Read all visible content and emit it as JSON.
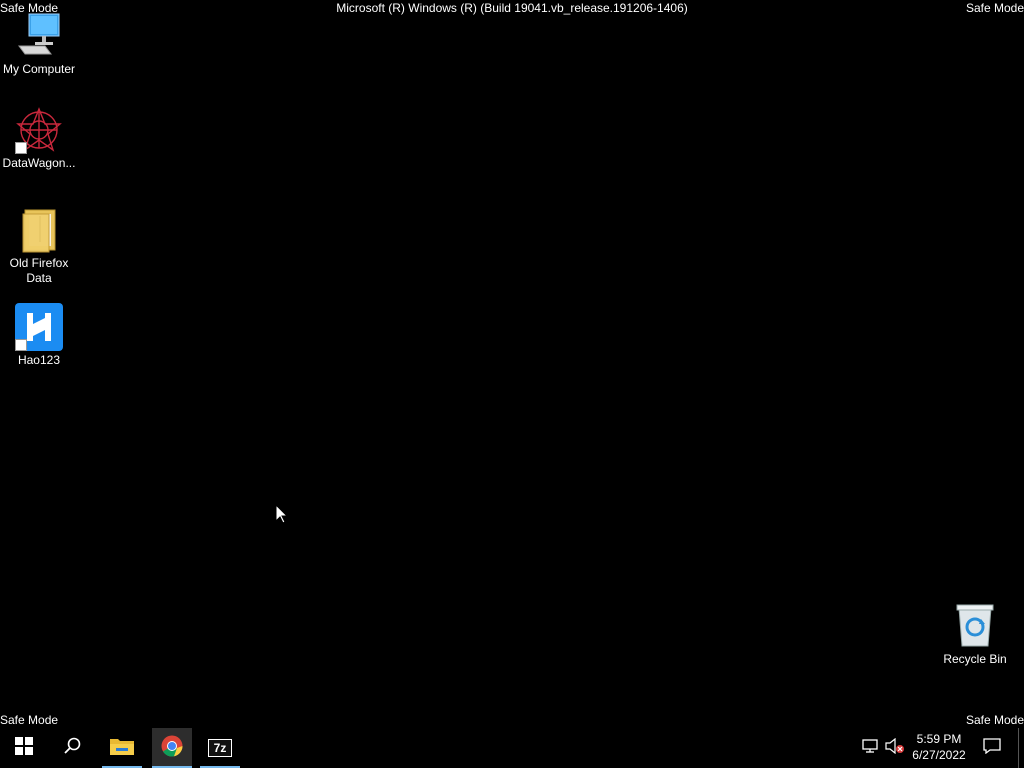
{
  "watermark": {
    "safe_mode": "Safe Mode",
    "build": "Microsoft (R) Windows (R) (Build 19041.vb_release.191206-1406)"
  },
  "desktop": {
    "icons": [
      {
        "label": "My Computer",
        "icon": "computer-icon"
      },
      {
        "label": "DataWagon...",
        "icon": "datawagon-icon"
      },
      {
        "label": "Old Firefox Data",
        "icon": "folder-icon"
      },
      {
        "label": "Hao123",
        "icon": "hao123-icon"
      },
      {
        "label": "Recycle Bin",
        "icon": "recycle-bin-icon"
      }
    ]
  },
  "taskbar": {
    "start": "windows-start-icon",
    "search": "search-icon",
    "apps": [
      {
        "name": "File Explorer",
        "icon": "file-explorer-icon"
      },
      {
        "name": "Google Chrome",
        "icon": "chrome-icon"
      },
      {
        "name": "7-Zip",
        "icon": "7zip-icon",
        "glyph": "7z"
      }
    ],
    "tray": {
      "network_icon": "network-icon",
      "volume_icon": "volume-muted-icon"
    },
    "clock": {
      "time": "5:59 PM",
      "date": "6/27/2022"
    },
    "notifications_icon": "action-center-icon"
  },
  "colors": {
    "background": "#000000",
    "accent": "#76b9ed"
  }
}
